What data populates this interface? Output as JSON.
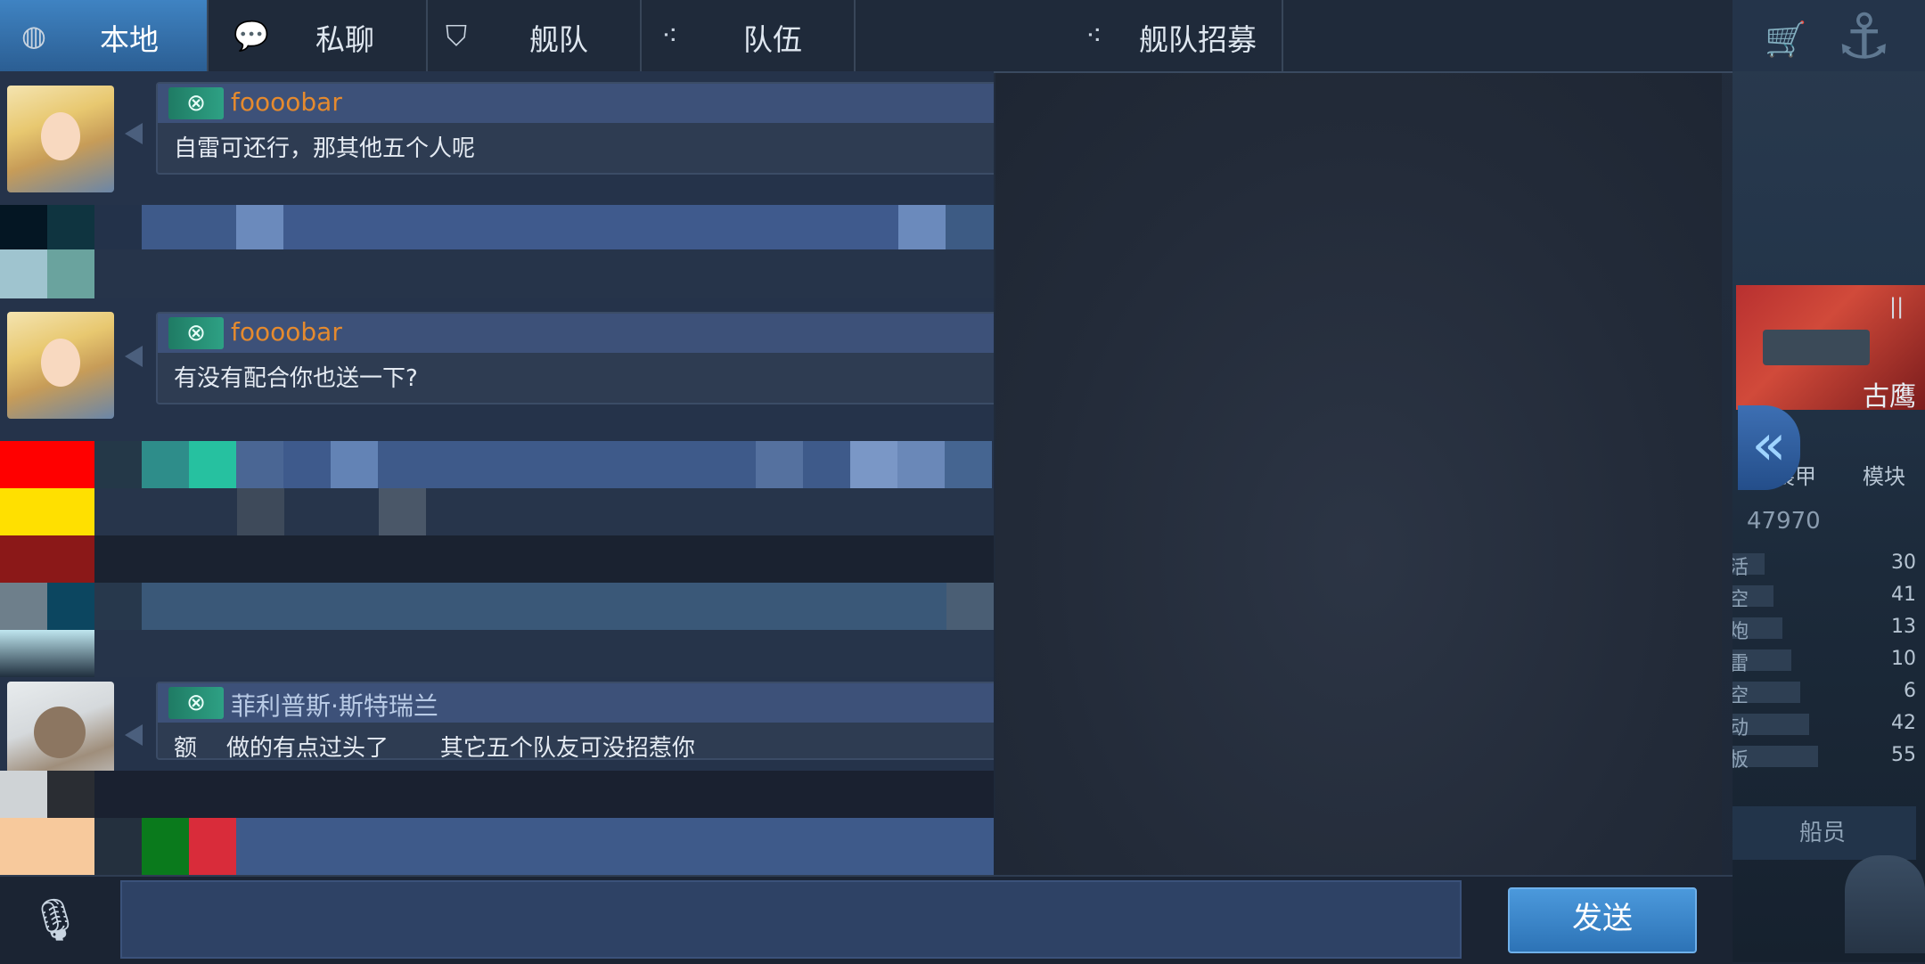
{
  "tabs": [
    {
      "label": "本地",
      "icon": "globe-icon"
    },
    {
      "label": "私聊",
      "icon": "chat-bubble-icon"
    },
    {
      "label": "舰队",
      "icon": "fleet-emblem-icon"
    },
    {
      "label": "队伍",
      "icon": "team-icon"
    },
    {
      "label": "舰队招募",
      "icon": "recruit-icon"
    }
  ],
  "messages": [
    {
      "username": "foooobar",
      "text": "自雷可还行，那其他五个人呢",
      "avatar": "blonde-avatar"
    },
    {
      "username": "foooobar",
      "text": "有没有配合你也送一下?",
      "avatar": "blonde-avatar"
    },
    {
      "username": "菲利普斯·斯特瑞兰",
      "text": "额    做的有点过头了       其它五个队友可没招惹你",
      "avatar": "monkey-avatar"
    }
  ],
  "input": {
    "send_label": "发送",
    "value": ""
  },
  "side_panel": {
    "ship_name": "古鹰",
    "tab_armor": "装甲",
    "tab_module": "模块",
    "power": "47970",
    "stats": [
      {
        "label": "活",
        "value": "30"
      },
      {
        "label": "空",
        "value": "41"
      },
      {
        "label": "炮",
        "value": "13"
      },
      {
        "label": "雷",
        "value": "10"
      },
      {
        "label": "空",
        "value": "6"
      },
      {
        "label": "动",
        "value": "42"
      },
      {
        "label": "板",
        "value": "55"
      }
    ],
    "crew_label": "船员"
  },
  "colors": {
    "accent": "#3f83c2",
    "username_orange": "#e58a2e",
    "send_blue": "#3d8ad0"
  }
}
